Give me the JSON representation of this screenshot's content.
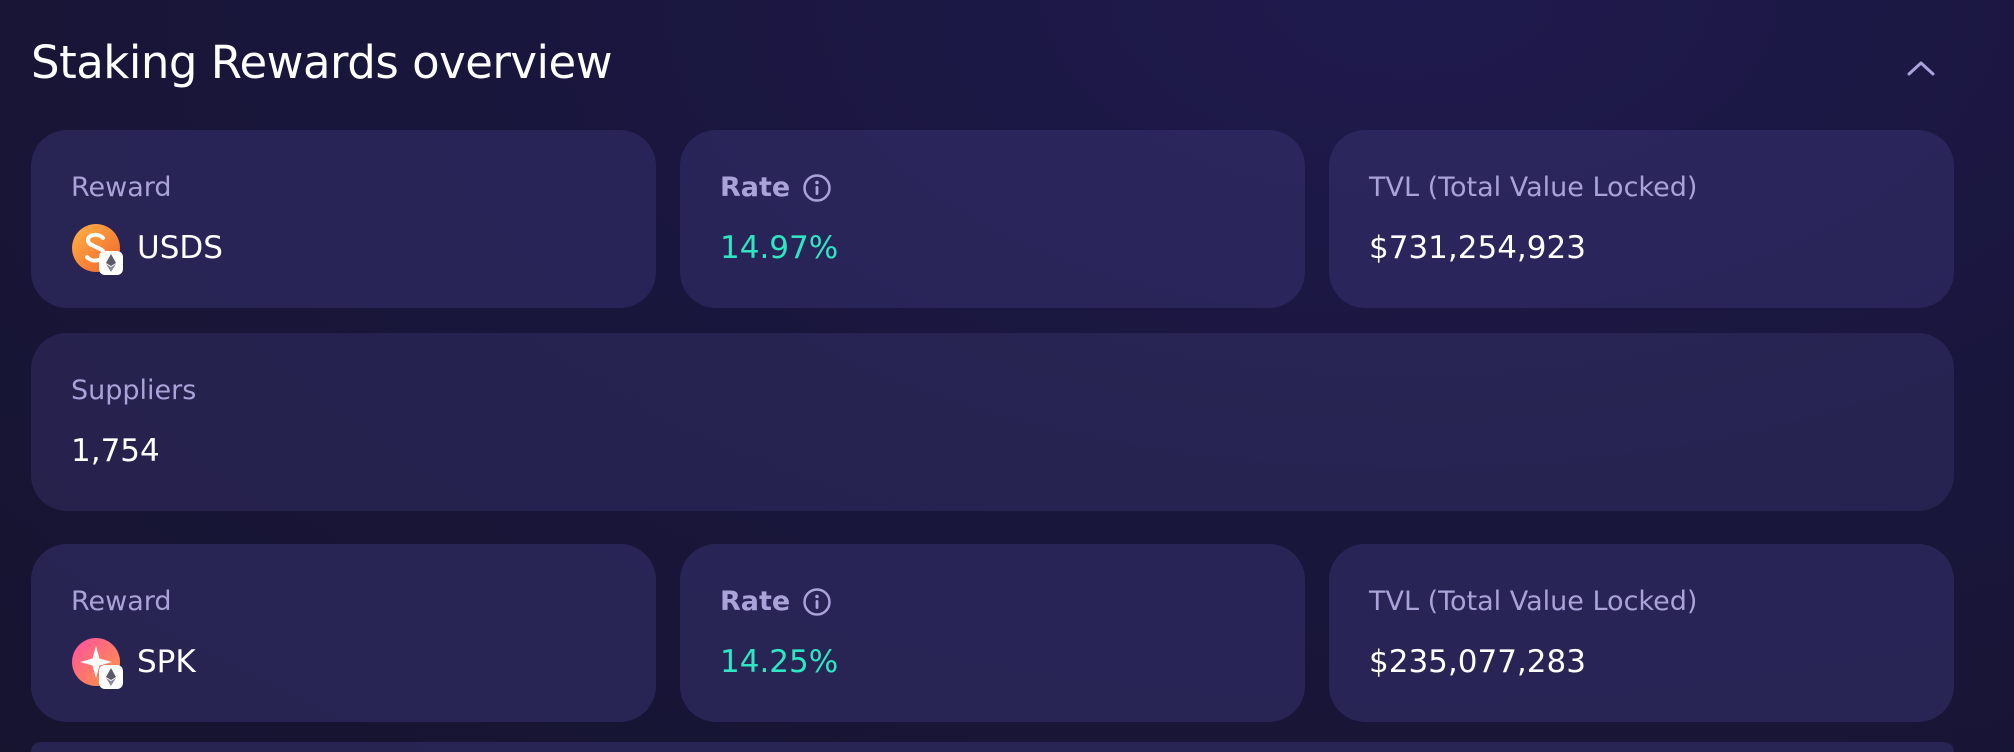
{
  "header": {
    "title": "Staking Rewards overview"
  },
  "colors": {
    "background": "#19163d",
    "card": "#2a2660",
    "label": "#a9a3d9",
    "rate": "#2ee6c3",
    "value": "#ffffff"
  },
  "icons": {
    "collapse": "chevron-up-icon",
    "info": "info-icon",
    "usds": "usds-token-icon",
    "spk": "spk-token-icon",
    "network": "ethereum-icon"
  },
  "rewards": [
    {
      "reward_label": "Reward",
      "token": "USDS",
      "rate_label": "Rate",
      "rate": "14.97%",
      "tvl_label": "TVL (Total Value Locked)",
      "tvl": "$731,254,923"
    },
    {
      "reward_label": "Reward",
      "token": "SPK",
      "rate_label": "Rate",
      "rate": "14.25%",
      "tvl_label": "TVL (Total Value Locked)",
      "tvl": "$235,077,283"
    }
  ],
  "suppliers": {
    "label": "Suppliers",
    "value": "1,754"
  }
}
